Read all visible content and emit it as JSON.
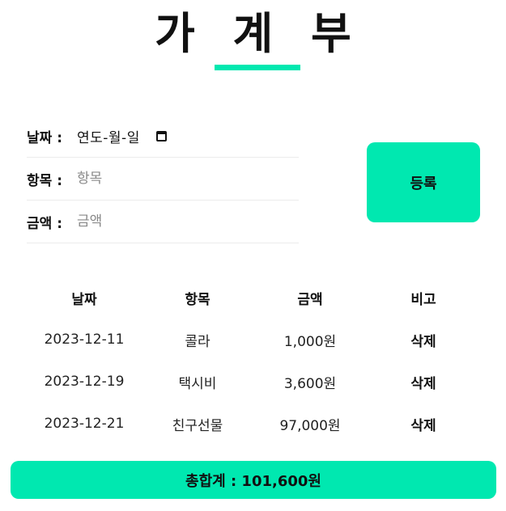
{
  "title": "가 계 부",
  "form": {
    "date_label": "날짜 :",
    "date_placeholder": "연도-월-일",
    "item_label": "항목 :",
    "item_placeholder": "항목",
    "amount_label": "금액 :",
    "amount_placeholder": "금액",
    "submit_label": "등록"
  },
  "table": {
    "headers": [
      "날짜",
      "항목",
      "금액",
      "비고"
    ],
    "rows": [
      {
        "date": "2023-12-11",
        "item": "콜라",
        "amount": "1,000원",
        "action": "삭제"
      },
      {
        "date": "2023-12-19",
        "item": "택시비",
        "amount": "3,600원",
        "action": "삭제"
      },
      {
        "date": "2023-12-21",
        "item": "친구선물",
        "amount": "97,000원",
        "action": "삭제"
      }
    ]
  },
  "total": "총합계 : 101,600원",
  "colors": {
    "accent": "#00e8b0",
    "text": "#111111",
    "divider": "#ececec"
  },
  "icons": {
    "date_picker": "calendar-icon"
  }
}
